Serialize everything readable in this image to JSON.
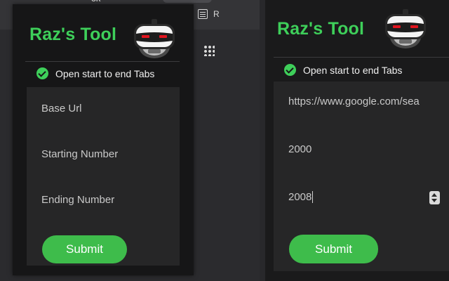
{
  "browser": {
    "tab_hint": "OR",
    "reader_label": "R",
    "icons": [
      "reading-list-icon",
      "apps-grid-icon"
    ]
  },
  "popup_empty": {
    "title": "Raz's Tool",
    "option_label": "Open start to end Tabs",
    "option_checked": true,
    "fields": [
      {
        "label": "Base Url",
        "value": ""
      },
      {
        "label": "Starting Number",
        "value": ""
      },
      {
        "label": "Ending Number",
        "value": ""
      }
    ],
    "submit_label": "Submit"
  },
  "popup_filled": {
    "title": "Raz's Tool",
    "option_label": "Open start to end Tabs",
    "option_checked": true,
    "fields": [
      {
        "label": "Base Url",
        "value": "https://www.google.com/sea"
      },
      {
        "label": "Starting Number",
        "value": "2000"
      },
      {
        "label": "Ending Number",
        "value": "2008"
      }
    ],
    "submit_label": "Submit"
  },
  "colors": {
    "accent_green": "#3ecf5a",
    "button_green": "#3ebc4b",
    "popup_bg": "#161617",
    "form_bg": "#262627",
    "robot_eyes": "#e0141e"
  }
}
